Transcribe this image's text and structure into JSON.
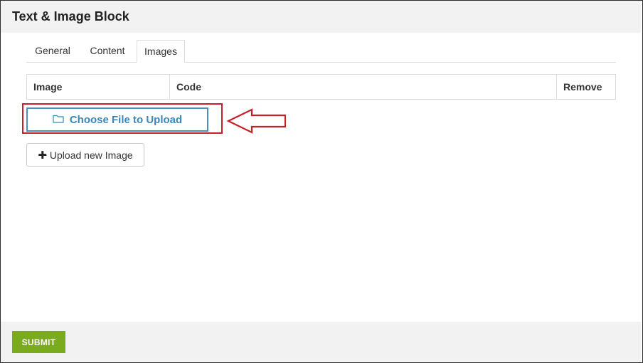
{
  "dialog": {
    "title": "Text & Image Block"
  },
  "tabs": [
    {
      "label": "General"
    },
    {
      "label": "Content"
    },
    {
      "label": "Images"
    }
  ],
  "active_tab": "Images",
  "table": {
    "columns": [
      {
        "label": "Image"
      },
      {
        "label": "Code"
      },
      {
        "label": "Remove"
      }
    ]
  },
  "choose_file": {
    "label": "Choose File to Upload",
    "icon": "folder-icon"
  },
  "upload_new": {
    "label": "Upload new Image",
    "icon": "plus-icon"
  },
  "annotation": {
    "color": "#c8202a"
  },
  "footer": {
    "submit_label": "SUBMIT"
  },
  "colors": {
    "accent_blue": "#3b86b8",
    "submit_green": "#7aab1f"
  }
}
